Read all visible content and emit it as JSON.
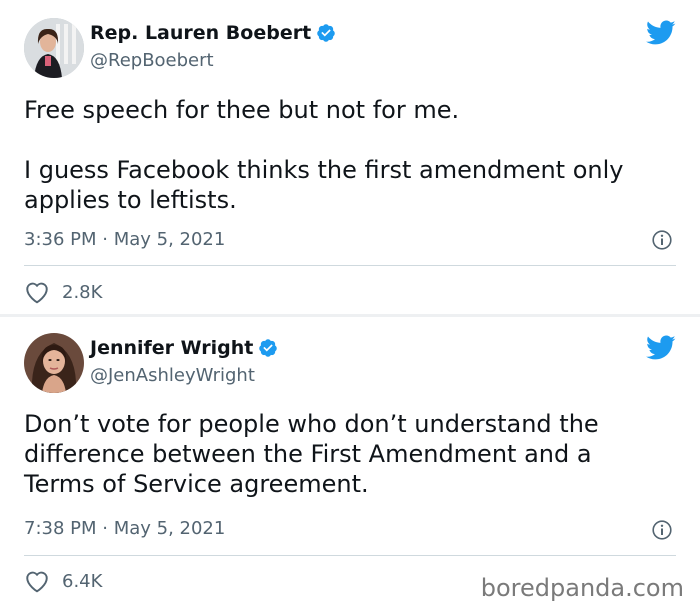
{
  "tweets": [
    {
      "name": "Rep. Lauren Boebert",
      "handle": "@RepBoebert",
      "text_lines": [
        "Free speech for thee but not for me.",
        "",
        "I guess Facebook thinks the first amendment only",
        "applies to leftists."
      ],
      "timestamp": "3:36 PM · May 5, 2021",
      "likes": "2.8K",
      "avatar_icon": "woman-portrait-avatar",
      "verified_icon": "verified-badge-icon",
      "brand_icon": "twitter-bird-icon"
    },
    {
      "name": "Jennifer Wright",
      "handle": "@JenAshleyWright",
      "text_lines": [
        "Don’t vote for people who don’t understand the",
        "difference between the First Amendment and a",
        "Terms of Service agreement."
      ],
      "timestamp": "7:38 PM · May 5, 2021",
      "likes": "6.4K",
      "avatar_icon": "woman-portrait-avatar",
      "verified_icon": "verified-badge-icon",
      "brand_icon": "twitter-bird-icon"
    }
  ],
  "watermark": "boredpanda.com",
  "colors": {
    "verified_blue": "#1d9bf0",
    "text_primary": "#0f1419",
    "text_secondary": "#536471",
    "divider": "#cfd9de"
  }
}
